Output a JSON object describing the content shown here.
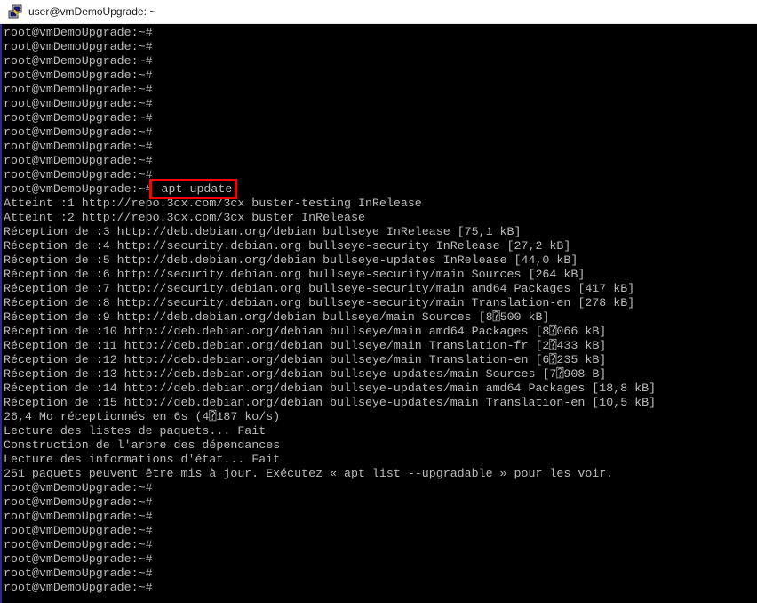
{
  "window": {
    "title": "user@vmDemoUpgrade: ~",
    "icon": "putty-icon"
  },
  "terminal": {
    "prompt": "root@vmDemoUpgrade:~#",
    "highlighted_command": " apt update",
    "highlight_color": "#ff0000",
    "text_color": "#bbbbbb",
    "background_color": "#000000",
    "lines": [
      "root@vmDemoUpgrade:~#",
      "root@vmDemoUpgrade:~#",
      "root@vmDemoUpgrade:~#",
      "root@vmDemoUpgrade:~#",
      "root@vmDemoUpgrade:~#",
      "root@vmDemoUpgrade:~#",
      "root@vmDemoUpgrade:~#",
      "root@vmDemoUpgrade:~#",
      "root@vmDemoUpgrade:~#",
      "root@vmDemoUpgrade:~#",
      "root@vmDemoUpgrade:~#",
      "",
      "Atteint :1 http://repo.3cx.com/3cx buster-testing InRelease",
      "Atteint :2 http://repo.3cx.com/3cx buster InRelease",
      "Réception de :3 http://deb.debian.org/debian bullseye InRelease [75,1 kB]",
      "Réception de :4 http://security.debian.org bullseye-security InRelease [27,2 kB]",
      "Réception de :5 http://deb.debian.org/debian bullseye-updates InRelease [44,0 kB]",
      "Réception de :6 http://security.debian.org bullseye-security/main Sources [264 kB]",
      "Réception de :7 http://security.debian.org bullseye-security/main amd64 Packages [417 kB]",
      "Réception de :8 http://security.debian.org bullseye-security/main Translation-en [278 kB]",
      "Réception de :9 http://deb.debian.org/debian bullseye/main Sources [8⍰500 kB]",
      "Réception de :10 http://deb.debian.org/debian bullseye/main amd64 Packages [8⍰066 kB]",
      "Réception de :11 http://deb.debian.org/debian bullseye/main Translation-fr [2⍰433 kB]",
      "Réception de :12 http://deb.debian.org/debian bullseye/main Translation-en [6⍰235 kB]",
      "Réception de :13 http://deb.debian.org/debian bullseye-updates/main Sources [7⍰908 B]",
      "Réception de :14 http://deb.debian.org/debian bullseye-updates/main amd64 Packages [18,8 kB]",
      "Réception de :15 http://deb.debian.org/debian bullseye-updates/main Translation-en [10,5 kB]",
      "26,4 Mo réceptionnés en 6s (4⍰187 ko/s)",
      "Lecture des listes de paquets... Fait",
      "Construction de l'arbre des dépendances",
      "Lecture des informations d'état... Fait",
      "251 paquets peuvent être mis à jour. Exécutez « apt list --upgradable » pour les voir.",
      "root@vmDemoUpgrade:~#",
      "root@vmDemoUpgrade:~#",
      "root@vmDemoUpgrade:~#",
      "root@vmDemoUpgrade:~#",
      "root@vmDemoUpgrade:~#",
      "root@vmDemoUpgrade:~#",
      "root@vmDemoUpgrade:~#",
      "root@vmDemoUpgrade:~#"
    ]
  }
}
